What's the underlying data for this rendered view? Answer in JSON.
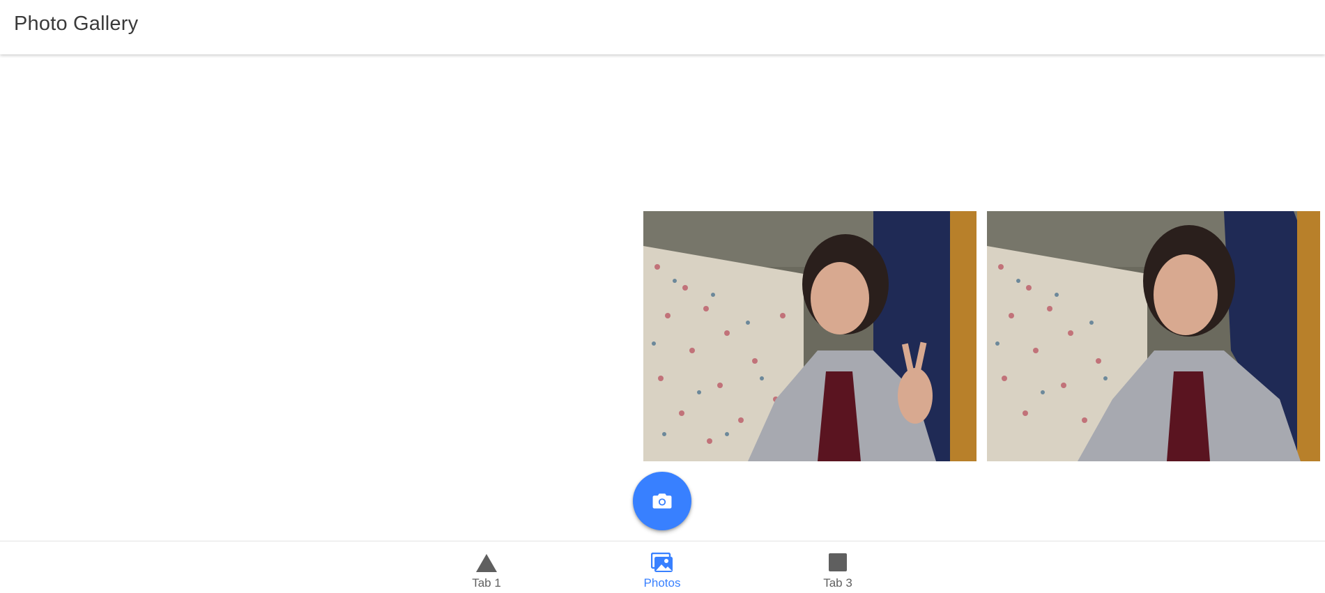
{
  "header": {
    "title": "Photo Gallery"
  },
  "gallery": {
    "photos": [
      {
        "icon": "photo-thumbnail"
      },
      {
        "icon": "photo-thumbnail"
      }
    ]
  },
  "fab": {
    "icon": "camera-icon",
    "color": "#3880ff"
  },
  "tabs": [
    {
      "label": "Tab 1",
      "icon": "triangle-icon",
      "selected": false
    },
    {
      "label": "Photos",
      "icon": "images-icon",
      "selected": true
    },
    {
      "label": "Tab 3",
      "icon": "square-icon",
      "selected": false
    }
  ],
  "colors": {
    "accent": "#3880ff",
    "tab_inactive": "#5f5f5f",
    "title_text": "#3a3a3a"
  }
}
